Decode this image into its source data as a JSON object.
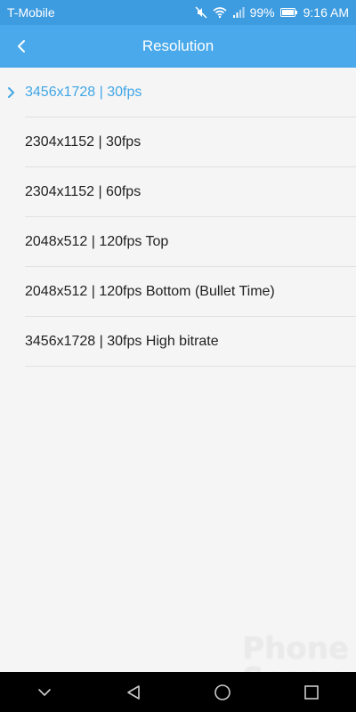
{
  "status_bar": {
    "carrier": "T-Mobile",
    "battery": "99%",
    "time": "9:16 AM"
  },
  "app_bar": {
    "title": "Resolution"
  },
  "resolutions": [
    {
      "label": "3456x1728 | 30fps",
      "selected": true
    },
    {
      "label": "2304x1152 | 30fps",
      "selected": false
    },
    {
      "label": "2304x1152 | 60fps",
      "selected": false
    },
    {
      "label": "2048x512 | 120fps Top",
      "selected": false
    },
    {
      "label": "2048x512 | 120fps Bottom (Bullet Time)",
      "selected": false
    },
    {
      "label": "3456x1728 | 30fps High bitrate",
      "selected": false
    }
  ],
  "watermark": {
    "line1": "Phone",
    "line2": "Scoop"
  },
  "colors": {
    "status_bar": "#3d9be0",
    "app_bar": "#4aa9ea",
    "accent": "#41a6e6",
    "background": "#f5f5f5"
  },
  "icons": {
    "back": "chevron-left-icon",
    "selected_marker": "chevron-right-icon",
    "nav": [
      "collapse-icon",
      "back-triangle-icon",
      "home-circle-icon",
      "recents-square-icon"
    ]
  }
}
